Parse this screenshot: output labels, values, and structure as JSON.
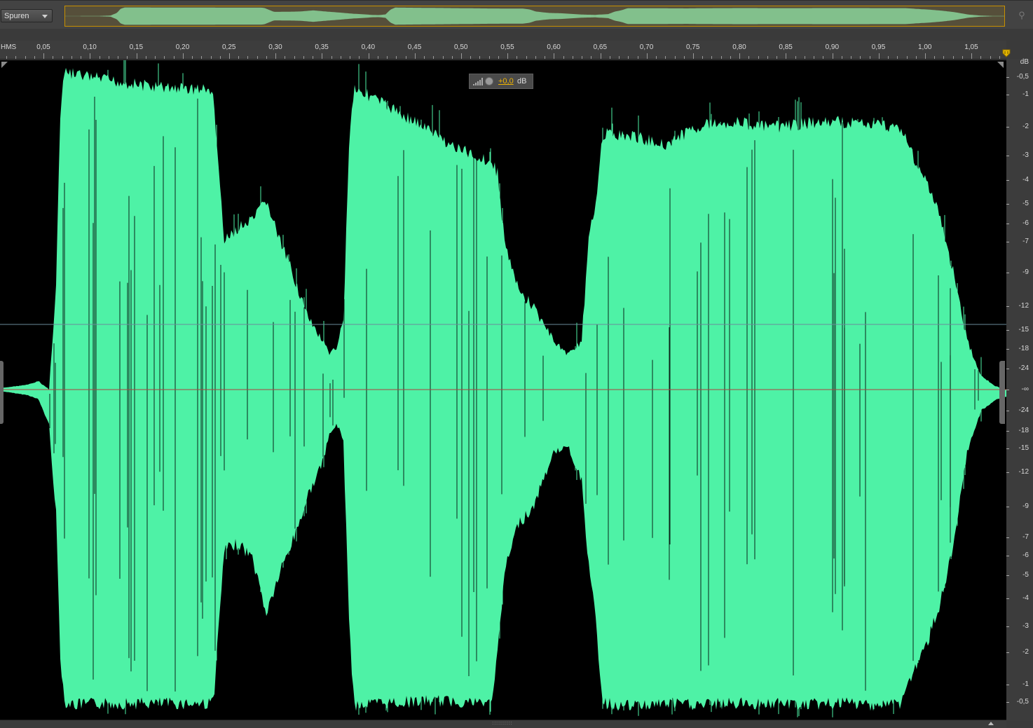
{
  "toolbar": {
    "view_dropdown_label": "Spuren",
    "zoom_icon": "magnifier-icon"
  },
  "timeline": {
    "unit_label": "HMS",
    "ticks": [
      "0,05",
      "0,10",
      "0,15",
      "0,20",
      "0,25",
      "0,30",
      "0,35",
      "0,40",
      "0,45",
      "0,50",
      "0,55",
      "0,60",
      "0,65",
      "0,70",
      "0,75",
      "0,80",
      "0,85",
      "0,90",
      "0,95",
      "1,00",
      "1,05"
    ]
  },
  "gain_hud": {
    "value": "+0,0",
    "unit": "dB"
  },
  "amplitude_scale": {
    "unit": "dB",
    "labels_top": [
      "-0,5",
      "-1",
      "-2",
      "-3",
      "-4",
      "-5",
      "-6",
      "-7",
      "-9",
      "-12",
      "-15",
      "-18",
      "-24"
    ],
    "center_label": "-∞",
    "labels_bottom": [
      "-24",
      "-18",
      "-15",
      "-12",
      "-9",
      "-7",
      "-6",
      "-5",
      "-4",
      "-3",
      "-2",
      "-1",
      "-0,5"
    ]
  },
  "colors": {
    "waveform": "#4ef2a6",
    "background": "#000000",
    "selection_border": "#c79000",
    "gain_value": "#f0b400"
  }
}
